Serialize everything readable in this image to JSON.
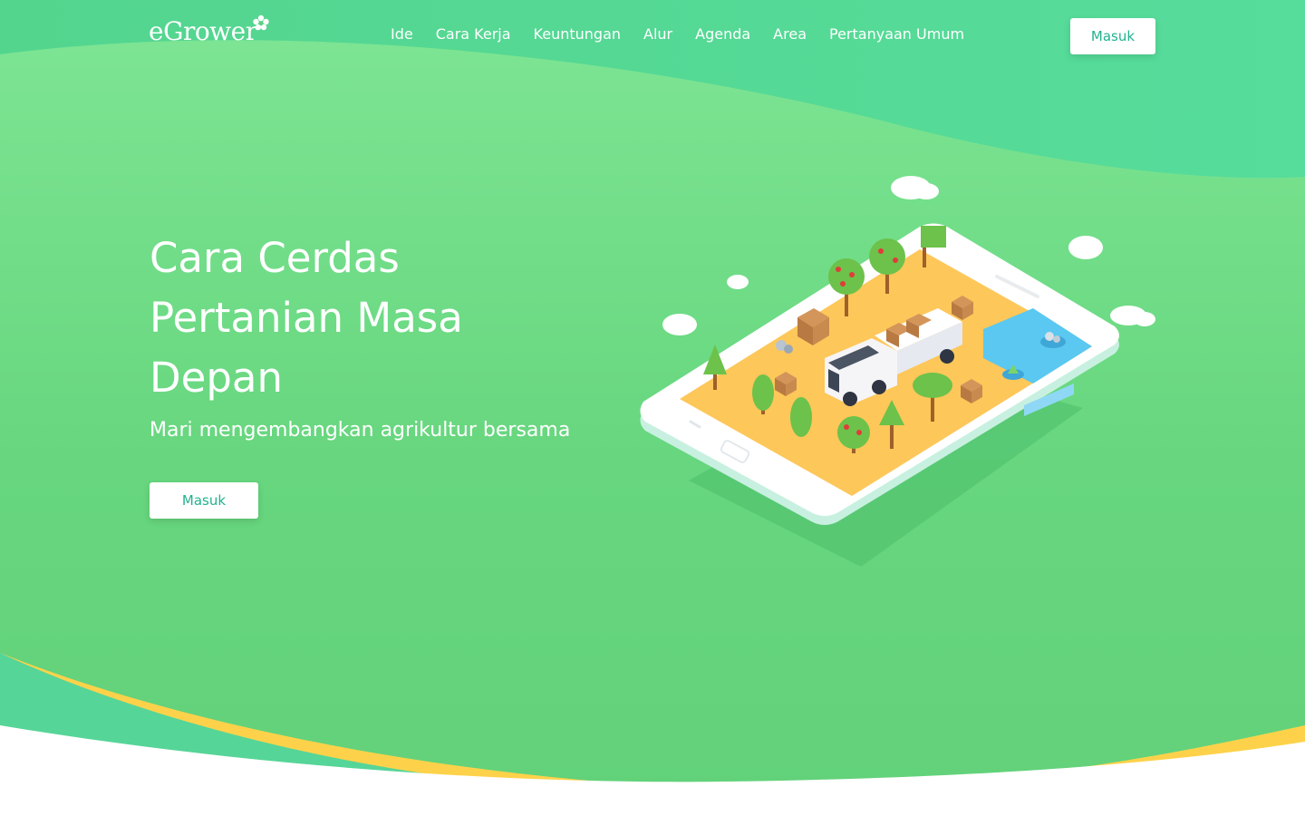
{
  "brand": {
    "name": "eGrower"
  },
  "nav": {
    "links": [
      "Ide",
      "Cara Kerja",
      "Keuntungan",
      "Alur",
      "Agenda",
      "Area",
      "Pertanyaan Umum"
    ],
    "login_label": "Masuk"
  },
  "hero": {
    "title_lines": [
      "Cara Cerdas",
      "Pertanian Masa",
      "Depan"
    ],
    "subtitle": "Mari mengembangkan agrikultur bersama",
    "cta_label": "Masuk"
  },
  "colors": {
    "primary_green": "#5dd17f",
    "light_green": "#7ee291",
    "teal": "#4fd69a",
    "accent_yellow": "#fdd24a",
    "button_text": "#21b38f"
  },
  "icons": {
    "logo_mark": "flower-icon",
    "illustration": "smart-farm-phone-illustration"
  }
}
